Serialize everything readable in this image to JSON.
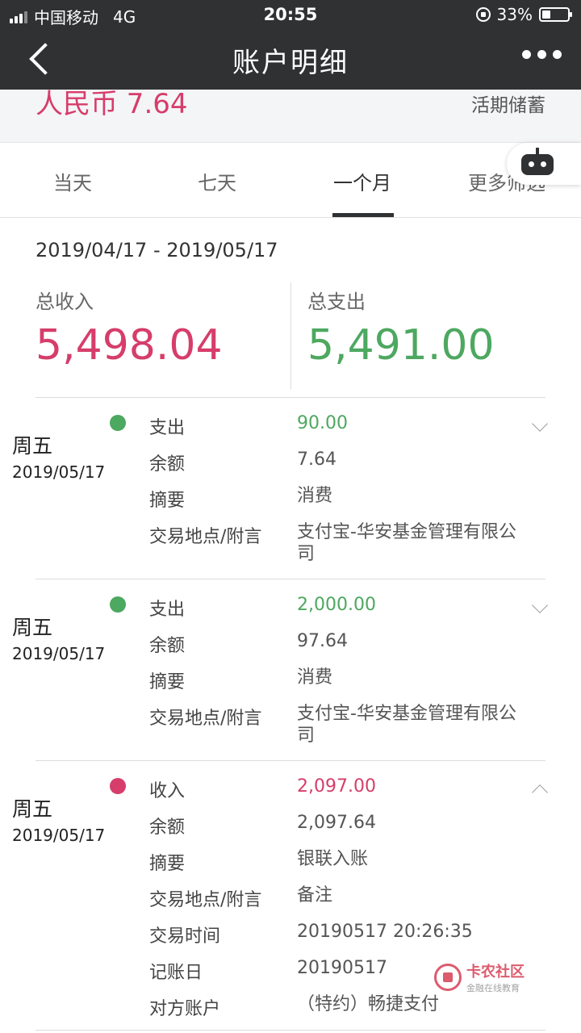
{
  "status": {
    "carrier": "中国移动",
    "network": "4G",
    "time": "20:55",
    "battery": "33%"
  },
  "nav": {
    "title": "账户明细"
  },
  "account": {
    "amount": "人民币 7.64",
    "type": "活期储蓄"
  },
  "tabs": [
    {
      "label": "当天"
    },
    {
      "label": "七天"
    },
    {
      "label": "一个月"
    },
    {
      "label": "更多筛选"
    }
  ],
  "active_tab": "一个月",
  "summary": {
    "range": "2019/04/17 - 2019/05/17",
    "income_label": "总收入",
    "income": "5,498.04",
    "expense_label": "总支出",
    "expense": "5,491.00"
  },
  "colors": {
    "income": "#d63d6a",
    "expense": "#4da860",
    "header": "#2f3133"
  },
  "entries": [
    {
      "weekday": "周五",
      "date": "2019/05/17",
      "kind": "expense",
      "expanded": false,
      "rows": [
        {
          "label": "支出",
          "value": "90.00"
        },
        {
          "label": "余额",
          "value": "7.64"
        },
        {
          "label": "摘要",
          "value": "消费"
        },
        {
          "label": "交易地点/附言",
          "value": "支付宝-华安基金管理有限公司"
        }
      ]
    },
    {
      "weekday": "周五",
      "date": "2019/05/17",
      "kind": "expense",
      "expanded": false,
      "rows": [
        {
          "label": "支出",
          "value": "2,000.00"
        },
        {
          "label": "余额",
          "value": "97.64"
        },
        {
          "label": "摘要",
          "value": "消费"
        },
        {
          "label": "交易地点/附言",
          "value": "支付宝-华安基金管理有限公司"
        }
      ]
    },
    {
      "weekday": "周五",
      "date": "2019/05/17",
      "kind": "income",
      "expanded": true,
      "rows": [
        {
          "label": "收入",
          "value": "2,097.00"
        },
        {
          "label": "余额",
          "value": "2,097.64"
        },
        {
          "label": "摘要",
          "value": "银联入账"
        },
        {
          "label": "交易地点/附言",
          "value": "备注"
        },
        {
          "label": "交易时间",
          "value": "20190517 20:26:35"
        },
        {
          "label": "记账日",
          "value": "20190517"
        },
        {
          "label": "对方账户",
          "value": "（特约）畅捷支付"
        }
      ]
    }
  ],
  "watermark": {
    "title": "卡农社区",
    "subtitle": "金融在线教育"
  }
}
